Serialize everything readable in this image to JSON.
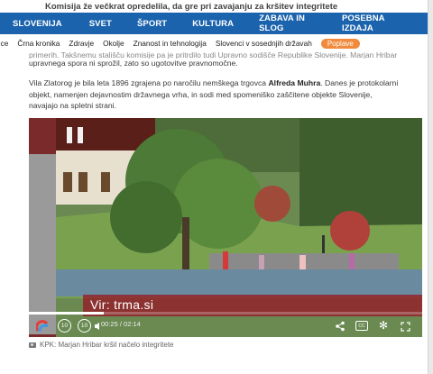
{
  "article": {
    "under_title": "Komisija že večkrat opredelila, da gre pri zavajanju za kršitev integritete",
    "para1_ghost": "primerih. Takšnemu stališču komisije pa je pritrdilo tudi Upravno sodišče Republike Slovenije. Marjan Hribar",
    "para1_line": "upravnega spora ni sprožil, zato so ugotovitve pravnomočne.",
    "para2_a": "Vila Zlatorog je bila leta 1896 zgrajena po naročilu nemškega trgovca ",
    "para2_bold": "Alfreda Muhra",
    "para2_b": ". Danes je protokolarni objekt, namenjen dejavnostim državnega vrha, in sodi med spomeniško zaščitene objekte Slovenije, navajajo na spletni strani.",
    "caption": "KPK: Marjan Hribar kršil načelo integritete"
  },
  "nav": {
    "items": [
      "SLOVENIJA",
      "SVET",
      "ŠPORT",
      "KULTURA",
      "ZABAVA IN SLOG",
      "POSEBNA IZDAJA"
    ]
  },
  "subnav": {
    "items": [
      "ovice",
      "Črna kronika",
      "Zdravje",
      "Okolje",
      "Znanost in tehnologija",
      "Slovenci v sosednjih državah"
    ],
    "pill": "Poplave"
  },
  "video": {
    "watermark": "Vir: trma.si",
    "time": "00:25 / 02:14",
    "progress": 0.19,
    "icons": [
      "logo-icon",
      "rewind-10-icon",
      "forward-10-icon",
      "volume-icon",
      "share-icon",
      "subtitles-icon",
      "settings-icon",
      "fullscreen-icon"
    ]
  },
  "colors": {
    "nav_bg": "#1b63ad",
    "pill": "#f08a3c",
    "watermark": "#961928"
  }
}
